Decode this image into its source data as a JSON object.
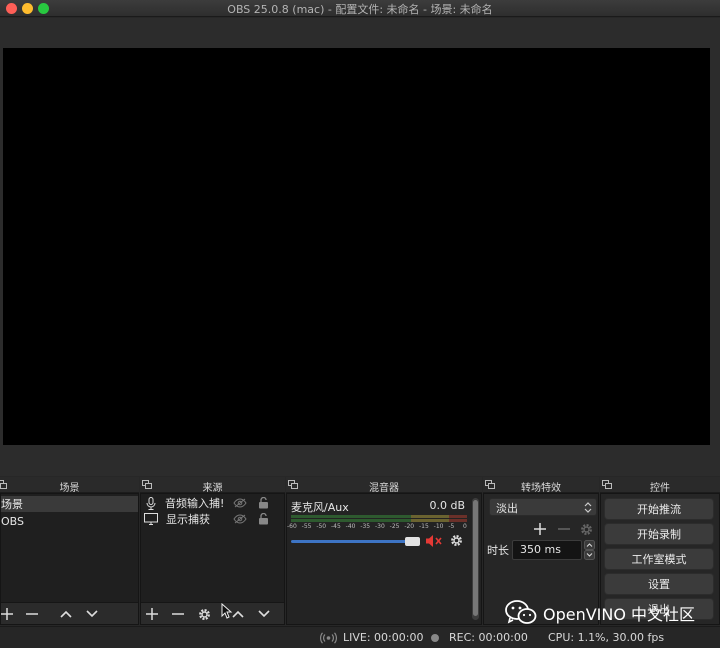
{
  "window": {
    "title": "OBS 25.0.8 (mac) - 配置文件: 未命名 - 场景: 未命名"
  },
  "docks": {
    "scenes": {
      "title": "场景",
      "items": [
        "场景",
        "OBS"
      ]
    },
    "sources": {
      "title": "来源",
      "items": [
        {
          "label": "音频输入捕!",
          "icon": "microphone-icon"
        },
        {
          "label": "显示捕获",
          "icon": "monitor-icon"
        }
      ]
    },
    "mixer": {
      "title": "混音器",
      "channel_name": "麦克风/Aux",
      "channel_db": "0.0 dB",
      "scale": [
        "-60",
        "-55",
        "-50",
        "-45",
        "-40",
        "-35",
        "-30",
        "-25",
        "-20",
        "-15",
        "-10",
        "-5",
        "0"
      ],
      "volume_level": 0.9
    },
    "transitions": {
      "title": "转场特效",
      "selected": "淡出",
      "duration_label": "时长",
      "duration_value": "350 ms"
    },
    "controls": {
      "title": "控件",
      "buttons": [
        "开始推流",
        "开始录制",
        "工作室模式",
        "设置",
        "退出"
      ]
    }
  },
  "status": {
    "live": "LIVE: 00:00:00",
    "rec": "REC: 00:00:00",
    "cpu": "CPU: 1.1%, 30.00 fps"
  },
  "watermark": {
    "text": "OpenVINO 中文社区"
  },
  "colors": {
    "accent_blue": "#3d74c4",
    "meter_green": "#4caf50",
    "meter_yellow": "#c8b43a",
    "meter_red": "#c84b3a",
    "mute_red": "#e53935"
  }
}
